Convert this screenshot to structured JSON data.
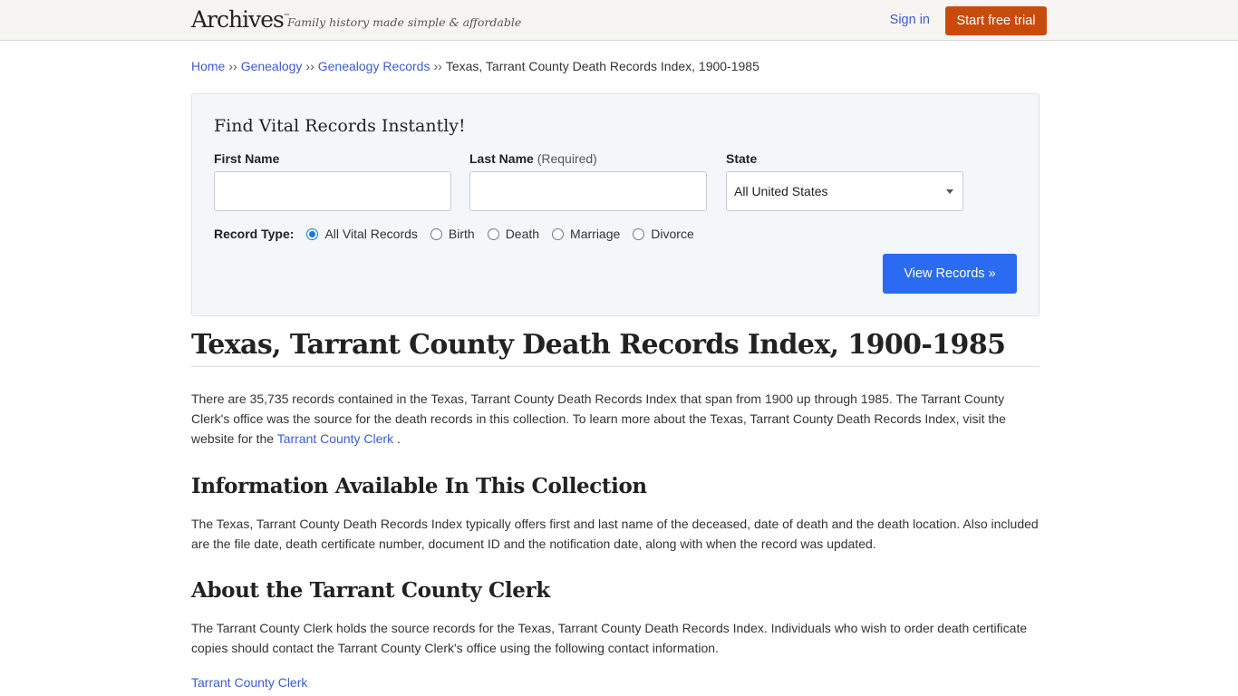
{
  "header": {
    "logo": "Archives",
    "logo_tm": "™",
    "tagline": "Family history made simple & affordable",
    "signin": "Sign in",
    "trial_button": "Start free trial"
  },
  "breadcrumb": {
    "items": [
      "Home",
      "Genealogy",
      "Genealogy Records"
    ],
    "separator": "››",
    "current": "Texas, Tarrant County Death Records Index, 1900-1985"
  },
  "search": {
    "title": "Find Vital Records Instantly!",
    "first_name_label": "First Name",
    "first_name_value": "",
    "last_name_label": "Last Name",
    "last_name_note": "(Required)",
    "last_name_value": "",
    "state_label": "State",
    "state_value": "All United States",
    "record_type_label": "Record Type:",
    "record_types": [
      {
        "label": "All Vital Records",
        "checked": true
      },
      {
        "label": "Birth",
        "checked": false
      },
      {
        "label": "Death",
        "checked": false
      },
      {
        "label": "Marriage",
        "checked": false
      },
      {
        "label": "Divorce",
        "checked": false
      }
    ],
    "submit": "View Records »"
  },
  "content": {
    "title": "Texas, Tarrant County Death Records Index, 1900-1985",
    "intro_before_link": "There are 35,735 records contained in the Texas, Tarrant County Death Records Index that span from 1900 up through 1985. The Tarrant County Clerk's office was the source for the death records in this collection. To learn more about the Texas, Tarrant County Death Records Index, visit the website for the ",
    "intro_link": "Tarrant County Clerk",
    "intro_after_link": " .",
    "section1_title": "Information Available In This Collection",
    "section1_text": "The Texas, Tarrant County Death Records Index typically offers first and last name of the deceased, date of death and the death location. Also included are the file date, death certificate number, document ID and the notification date, along with when the record was updated.",
    "section2_title": "About the Tarrant County Clerk",
    "section2_text": "The Tarrant County Clerk holds the source records for the Texas, Tarrant County Death Records Index. Individuals who wish to order death certificate copies should contact the Tarrant County Clerk's office using the following contact information.",
    "contact_link": "Tarrant County Clerk"
  }
}
